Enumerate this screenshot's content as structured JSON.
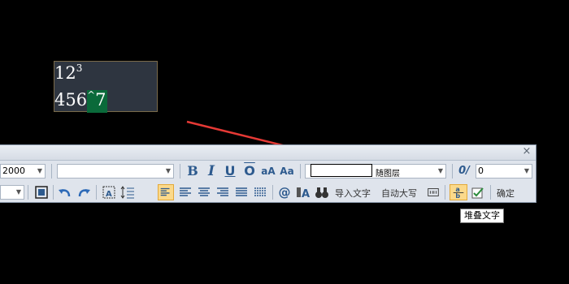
{
  "mtext": {
    "line1_base": "12",
    "line1_sup": "3",
    "line2_text": "456",
    "line2_caret": "^",
    "line2_sel": "7"
  },
  "toolbar": {
    "close_glyph": "×",
    "style_combo_value": "2000",
    "font_combo_value": "",
    "layer_label": "随图层",
    "oblique_label": "0/",
    "oblique_value": "0",
    "bold_label": "B",
    "italic_label": "I",
    "underline_label": "U",
    "overline_label": "O",
    "upper_label": "aA",
    "lower_label": "Aa",
    "at_label": "@",
    "import_text_label": "导入文字",
    "auto_caps_label": "自动大写",
    "ok_label": "确定"
  },
  "tooltip": {
    "text": "堆叠文字"
  },
  "colors": {
    "accent_active": "#fbd98a",
    "arrow": "#e53935",
    "selection": "#0a6a3a"
  }
}
